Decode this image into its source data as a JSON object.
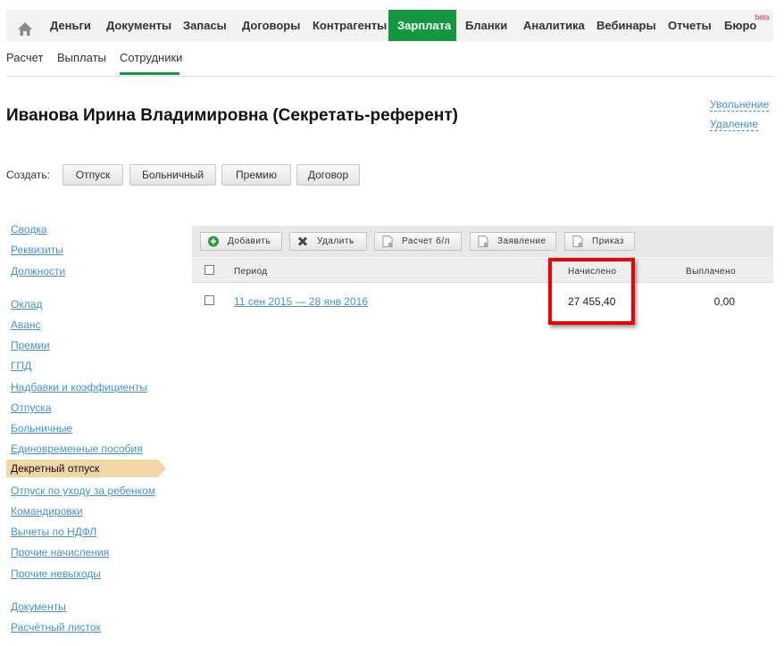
{
  "nav": {
    "items": [
      "Деньги",
      "Документы",
      "Запасы",
      "Договоры",
      "Контрагенты",
      "Зарплата",
      "Бланки",
      "Аналитика",
      "Вебинары",
      "Отчеты",
      "Бюро"
    ],
    "beta": "beta",
    "active": "Зарплата"
  },
  "subnav": [
    "Расчет",
    "Выплаты",
    "Сотрудники"
  ],
  "title": "Иванова Ирина Владимировна (Секретать-референт)",
  "actions": {
    "dismiss": "Увольнение",
    "delete": "Удаление"
  },
  "create": {
    "label": "Создать:",
    "buttons": [
      "Отпуск",
      "Больничный",
      "Премию",
      "Договор"
    ]
  },
  "sidebar": {
    "group1": [
      "Сводка",
      "Реквизиты",
      "Должности"
    ],
    "group2": [
      "Оклад",
      "Аванс",
      "Премии",
      "ГПД",
      "Надбавки и коэффициенты",
      "Отпуска",
      "Больничные",
      "Единовременные пособия"
    ],
    "active": "Декретный отпуск",
    "group3": [
      "Отпуск по уходу за ребенком",
      "Командировки",
      "Вычеты по НДФЛ",
      "Прочие начисления",
      "Прочие невыходы"
    ],
    "group4": [
      "Документы",
      "Расчётный листок"
    ]
  },
  "toolbar": [
    "Добавить",
    "Удалить",
    "Расчет б/л",
    "Заявление",
    "Приказ"
  ],
  "table": {
    "headers": [
      "Период",
      "Начислено",
      "Выплачено"
    ],
    "rows": [
      {
        "period": "11 сен 2015 — 28 янв 2016",
        "accrued": "27 455,40",
        "paid": "0,00"
      }
    ]
  },
  "colors": {
    "accent": "#13983f",
    "link": "#4a90c8",
    "highlight": "#e00000"
  }
}
